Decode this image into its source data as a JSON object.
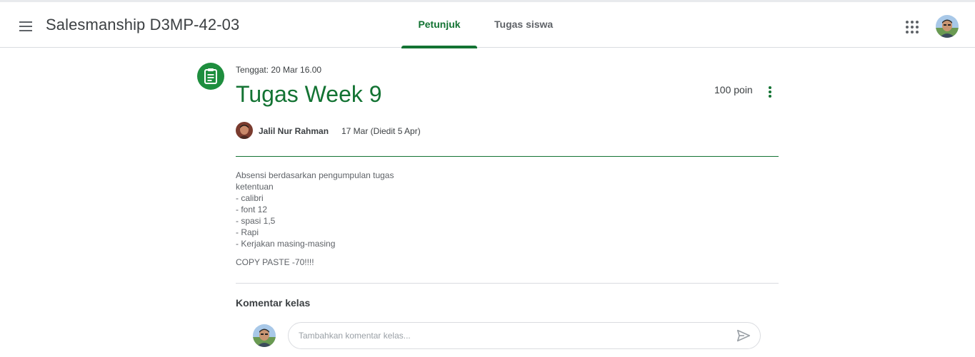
{
  "header": {
    "app_title": "Salesmanship D3MP-42-03",
    "tabs": [
      {
        "label": "Petunjuk",
        "active": true
      },
      {
        "label": "Tugas siswa",
        "active": false
      }
    ],
    "menu_icon": "hamburger-menu-icon",
    "apps_icon": "apps-grid-icon"
  },
  "assignment": {
    "icon": "assignment-icon",
    "due": "Tenggat: 20 Mar 16.00",
    "title": "Tugas Week 9",
    "points": "100 poin",
    "author": "Jalil Nur Rahman",
    "posted": "17 Mar (Diedit 5 Apr)",
    "description_lines": [
      "Absensi berdasarkan pengumpulan tugas",
      "ketentuan",
      "- calibri",
      "- font 12",
      "- spasi 1,5",
      "- Rapi",
      "- Kerjakan masing-masing"
    ],
    "description_footer": "COPY PASTE -70!!!!"
  },
  "comments": {
    "title": "Komentar kelas",
    "placeholder": "Tambahkan komentar kelas...",
    "value": ""
  },
  "colors": {
    "accent": "#137333",
    "icon_bg": "#1e8e3e",
    "text": "#3c4043",
    "muted": "#5f6368"
  }
}
